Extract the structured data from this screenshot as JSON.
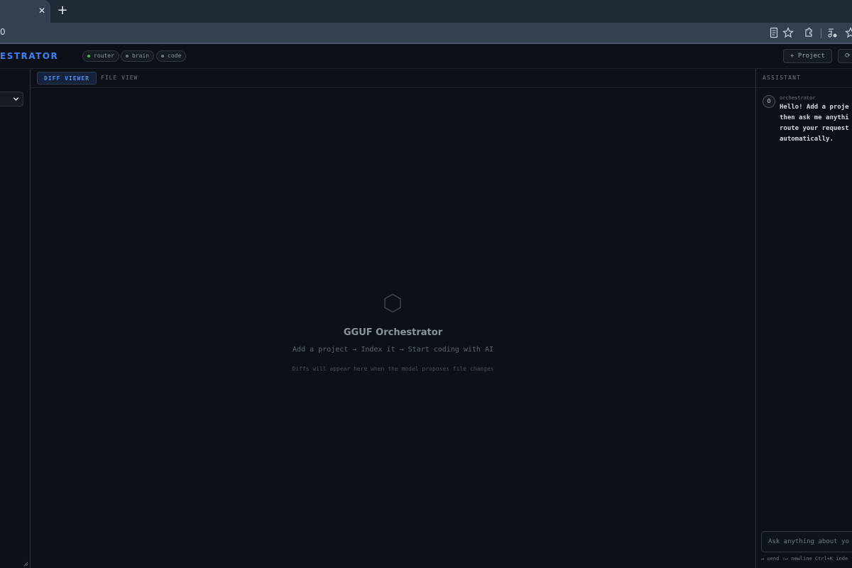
{
  "browser": {
    "tab_close": "✕",
    "new_tab": "+",
    "url": "0"
  },
  "header": {
    "title": "ESTRATOR",
    "models": [
      {
        "name": "router",
        "color": "#3fb950"
      },
      {
        "name": "brain",
        "color": "#6e7681"
      },
      {
        "name": "code",
        "color": "#6e7681"
      }
    ],
    "add_project": "+ Project",
    "refresh_icon": "⟳"
  },
  "center": {
    "tabs": {
      "diff_viewer": "DIFF VIEWER",
      "file_view": "FILE VIEW"
    },
    "empty_title": "GGUF Orchestrator",
    "empty_subtitle": "Add a project → Index it → Start coding with AI",
    "empty_hint": "Diffs will appear here when the model proposes file changes"
  },
  "assistant": {
    "title": "ASSISTANT",
    "message": {
      "avatar": "O",
      "sender": "orchestrator",
      "lines": [
        "Hello! Add a proje",
        "then ask me anythi",
        "route your request",
        "automatically."
      ]
    },
    "input_placeholder": "Ask anything about yo",
    "hint": "↵ send  ⇧↵ newline  Ctrl+K inde"
  },
  "colors": {
    "accent": "#3b82f6",
    "online": "#3fb950"
  }
}
